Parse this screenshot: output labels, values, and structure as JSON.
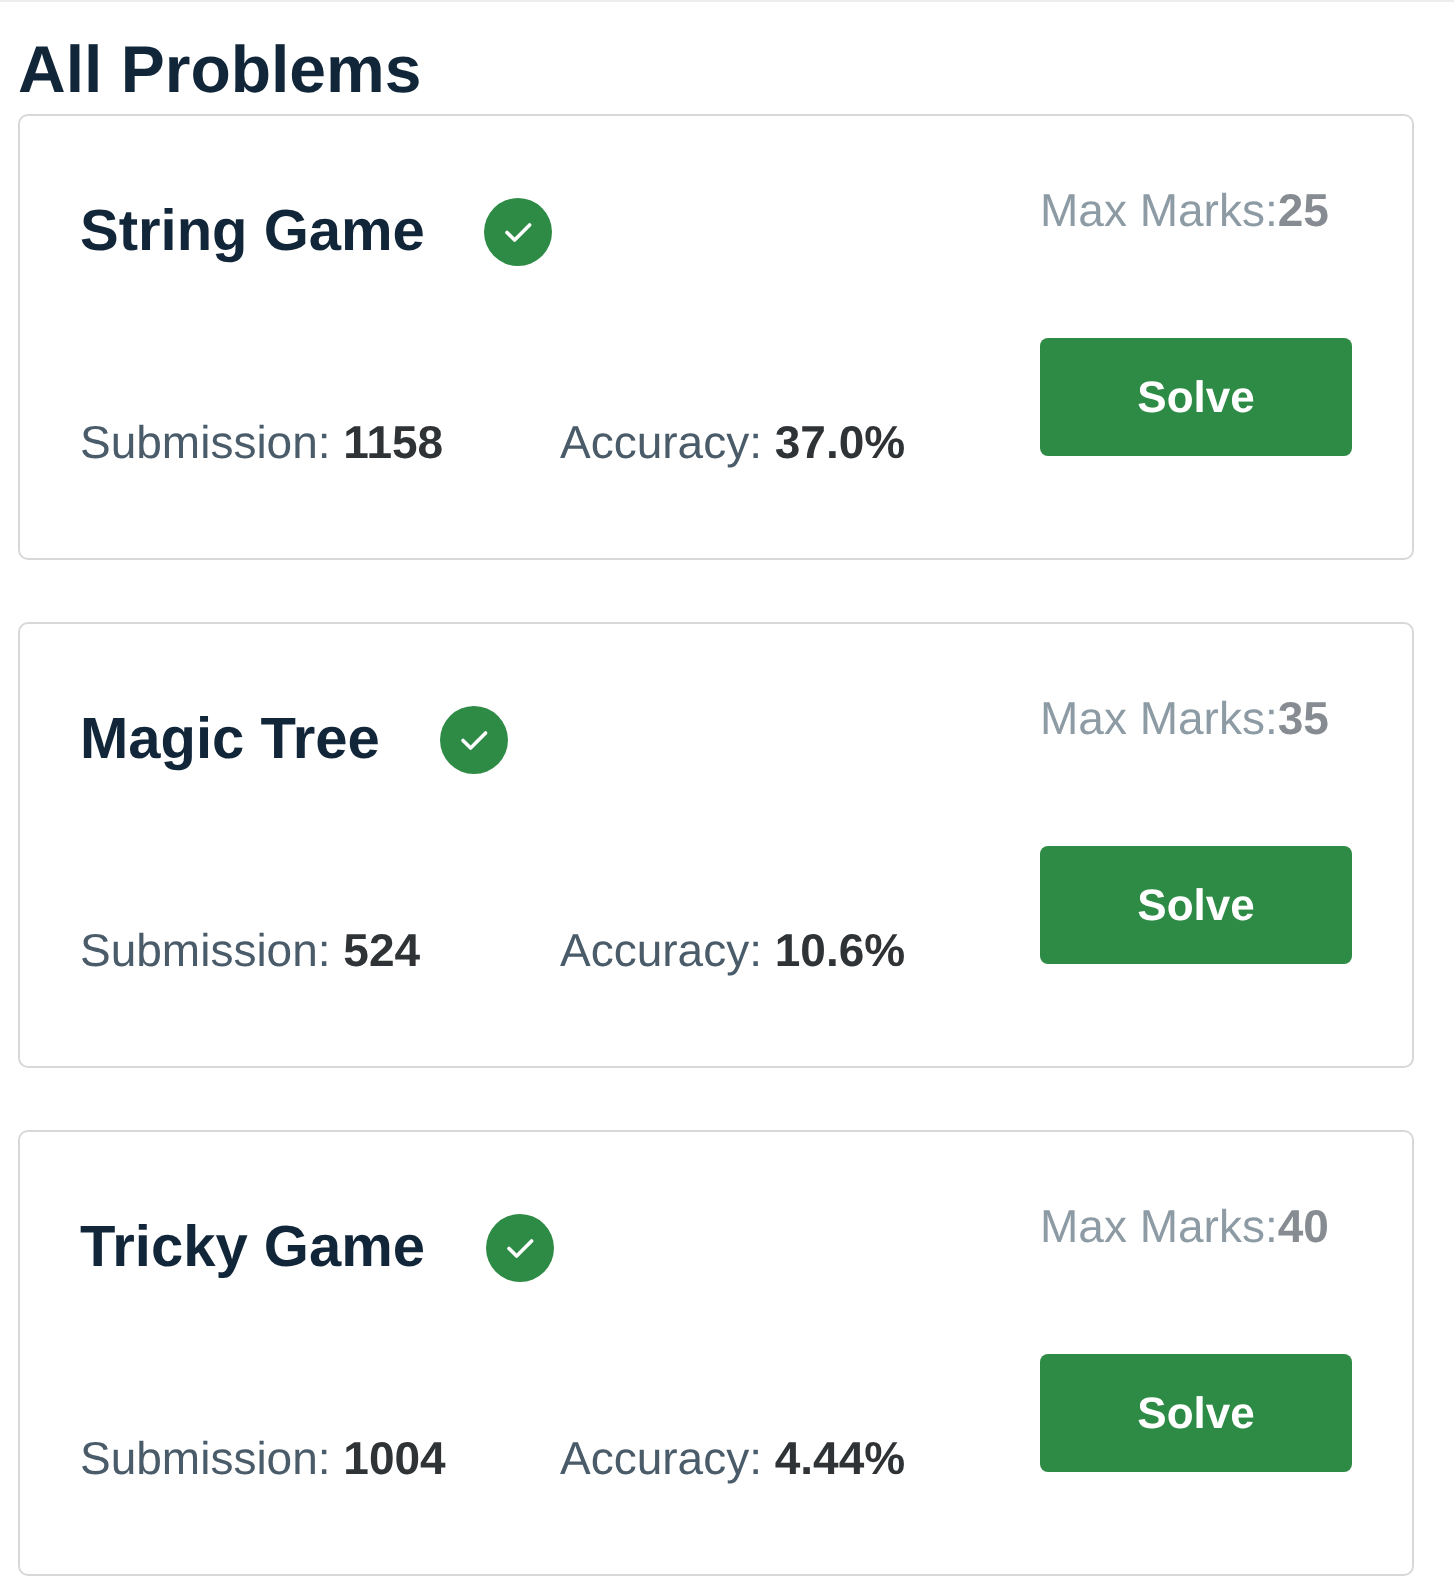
{
  "heading": "All Problems",
  "problems": [
    {
      "title": "String Game",
      "solved": true,
      "max_marks_label": "Max Marks:",
      "max_marks": "25",
      "button": "Solve",
      "submission_label": "Submission:",
      "submission": "1158",
      "accuracy_label": "Accuracy:",
      "accuracy": "37.0%"
    },
    {
      "title": "Magic Tree",
      "solved": true,
      "max_marks_label": "Max Marks:",
      "max_marks": "35",
      "button": "Solve",
      "submission_label": "Submission:",
      "submission": "524",
      "accuracy_label": "Accuracy:",
      "accuracy": "10.6%"
    },
    {
      "title": "Tricky Game",
      "solved": true,
      "max_marks_label": "Max Marks:",
      "max_marks": "40",
      "button": "Solve",
      "submission_label": "Submission:",
      "submission": "1004",
      "accuracy_label": "Accuracy:",
      "accuracy": "4.44%"
    }
  ]
}
